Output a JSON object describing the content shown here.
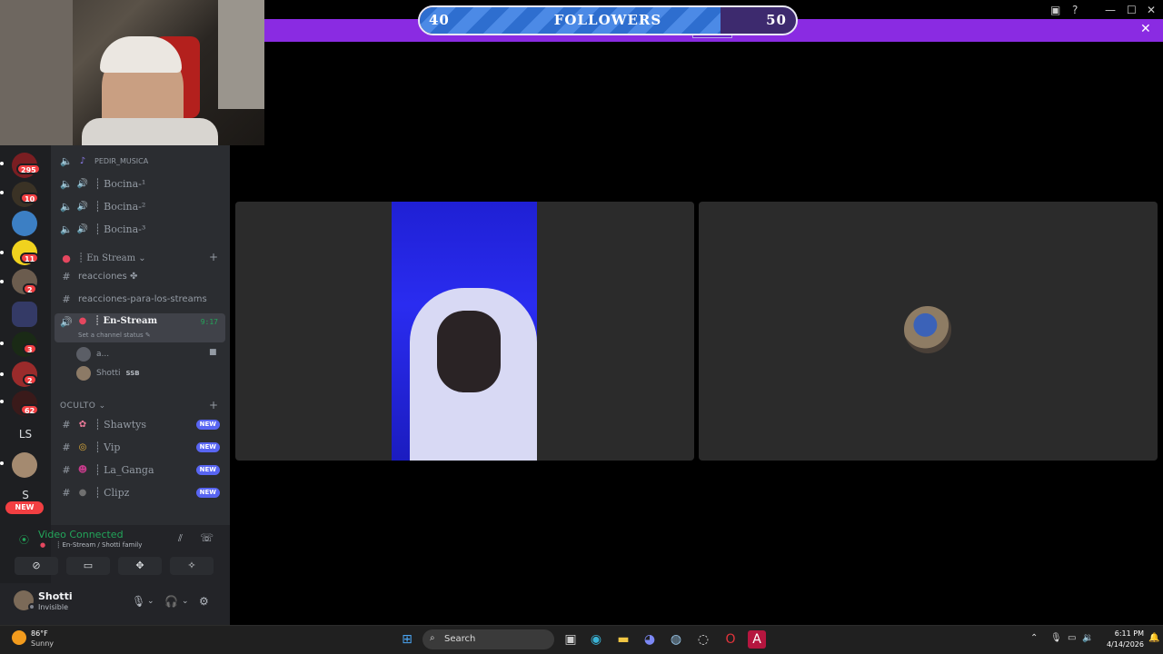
{
  "goal": {
    "start": "40",
    "label": "FOLLOWERS",
    "end": "50",
    "progress": 0.8
  },
  "servers": [
    {
      "badge": "295"
    },
    {
      "badge": "10"
    },
    {
      "badge": ""
    },
    {
      "badge": "11"
    },
    {
      "badge": "2"
    },
    {
      "badge": ""
    },
    {
      "badge": "3"
    },
    {
      "badge": "2"
    },
    {
      "badge": "62"
    }
  ],
  "server_text": {
    "ls": "LS",
    "s": "S",
    "new": "NEW"
  },
  "channels": {
    "pedir": "PEDIR_MUSICA",
    "bocina1": "┊ Bocina-¹",
    "bocina2": "┊ Bocina-²",
    "bocina3": "┊ Bocina-³",
    "cat_en_stream": "┊ En Stream ⌄",
    "reacciones": "reacciones ✤",
    "reacciones_streams": "reacciones-para-los-streams",
    "active": {
      "name": "┊ En-Stream",
      "time": "9:17",
      "status": "Set a channel status ✎"
    },
    "voice_users": [
      {
        "name": "a..."
      },
      {
        "name": "Shotti",
        "tag": "SSB"
      }
    ],
    "cat_oculto": "OCULTO ⌄",
    "hidden": [
      {
        "name": "┊ Shawtys",
        "badge": "NEW"
      },
      {
        "name": "┊ Vip",
        "badge": "NEW"
      },
      {
        "name": "┊ La_Ganga",
        "badge": "NEW"
      },
      {
        "name": "┊ Clipz",
        "badge": "NEW"
      }
    ]
  },
  "voice": {
    "status": "Video Connected",
    "channel": "┊ En-Stream / Shotti family"
  },
  "user": {
    "name": "Shotti",
    "status": "Invisible"
  },
  "taskbar": {
    "temp": "86°F",
    "weather": "Sunny",
    "search": "Search",
    "time": "6:11 PM",
    "date": "4/14/2026"
  }
}
